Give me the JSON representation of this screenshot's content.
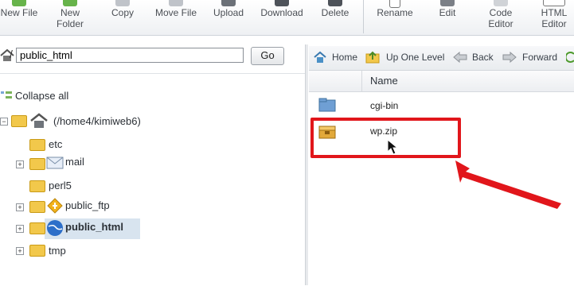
{
  "toolbar": {
    "items": [
      {
        "label": "New File"
      },
      {
        "label": "New Folder"
      },
      {
        "label": "Copy"
      },
      {
        "label": "Move File"
      },
      {
        "label": "Upload"
      },
      {
        "label": "Download"
      },
      {
        "label": "Delete"
      },
      {
        "label": "Rename"
      },
      {
        "label": "Edit"
      },
      {
        "label": "Code Editor"
      },
      {
        "label": "HTML Editor"
      }
    ]
  },
  "pathbar": {
    "value": "public_html",
    "go": "Go"
  },
  "nav": {
    "home": "Home",
    "up": "Up One Level",
    "back": "Back",
    "forward": "Forward"
  },
  "tree": {
    "collapse": "Collapse all",
    "root": "(/home4/kimiweb6)",
    "items": [
      {
        "label": "etc"
      },
      {
        "label": "mail"
      },
      {
        "label": "perl5"
      },
      {
        "label": "public_ftp"
      },
      {
        "label": "public_html"
      },
      {
        "label": "tmp"
      }
    ]
  },
  "list": {
    "header": "Name",
    "rows": [
      {
        "name": "cgi-bin"
      },
      {
        "name": "wp.zip"
      }
    ]
  },
  "colors": {
    "accent": "#e1161b",
    "highlight": "#d8e4ef",
    "folder": "#f2c84b"
  }
}
